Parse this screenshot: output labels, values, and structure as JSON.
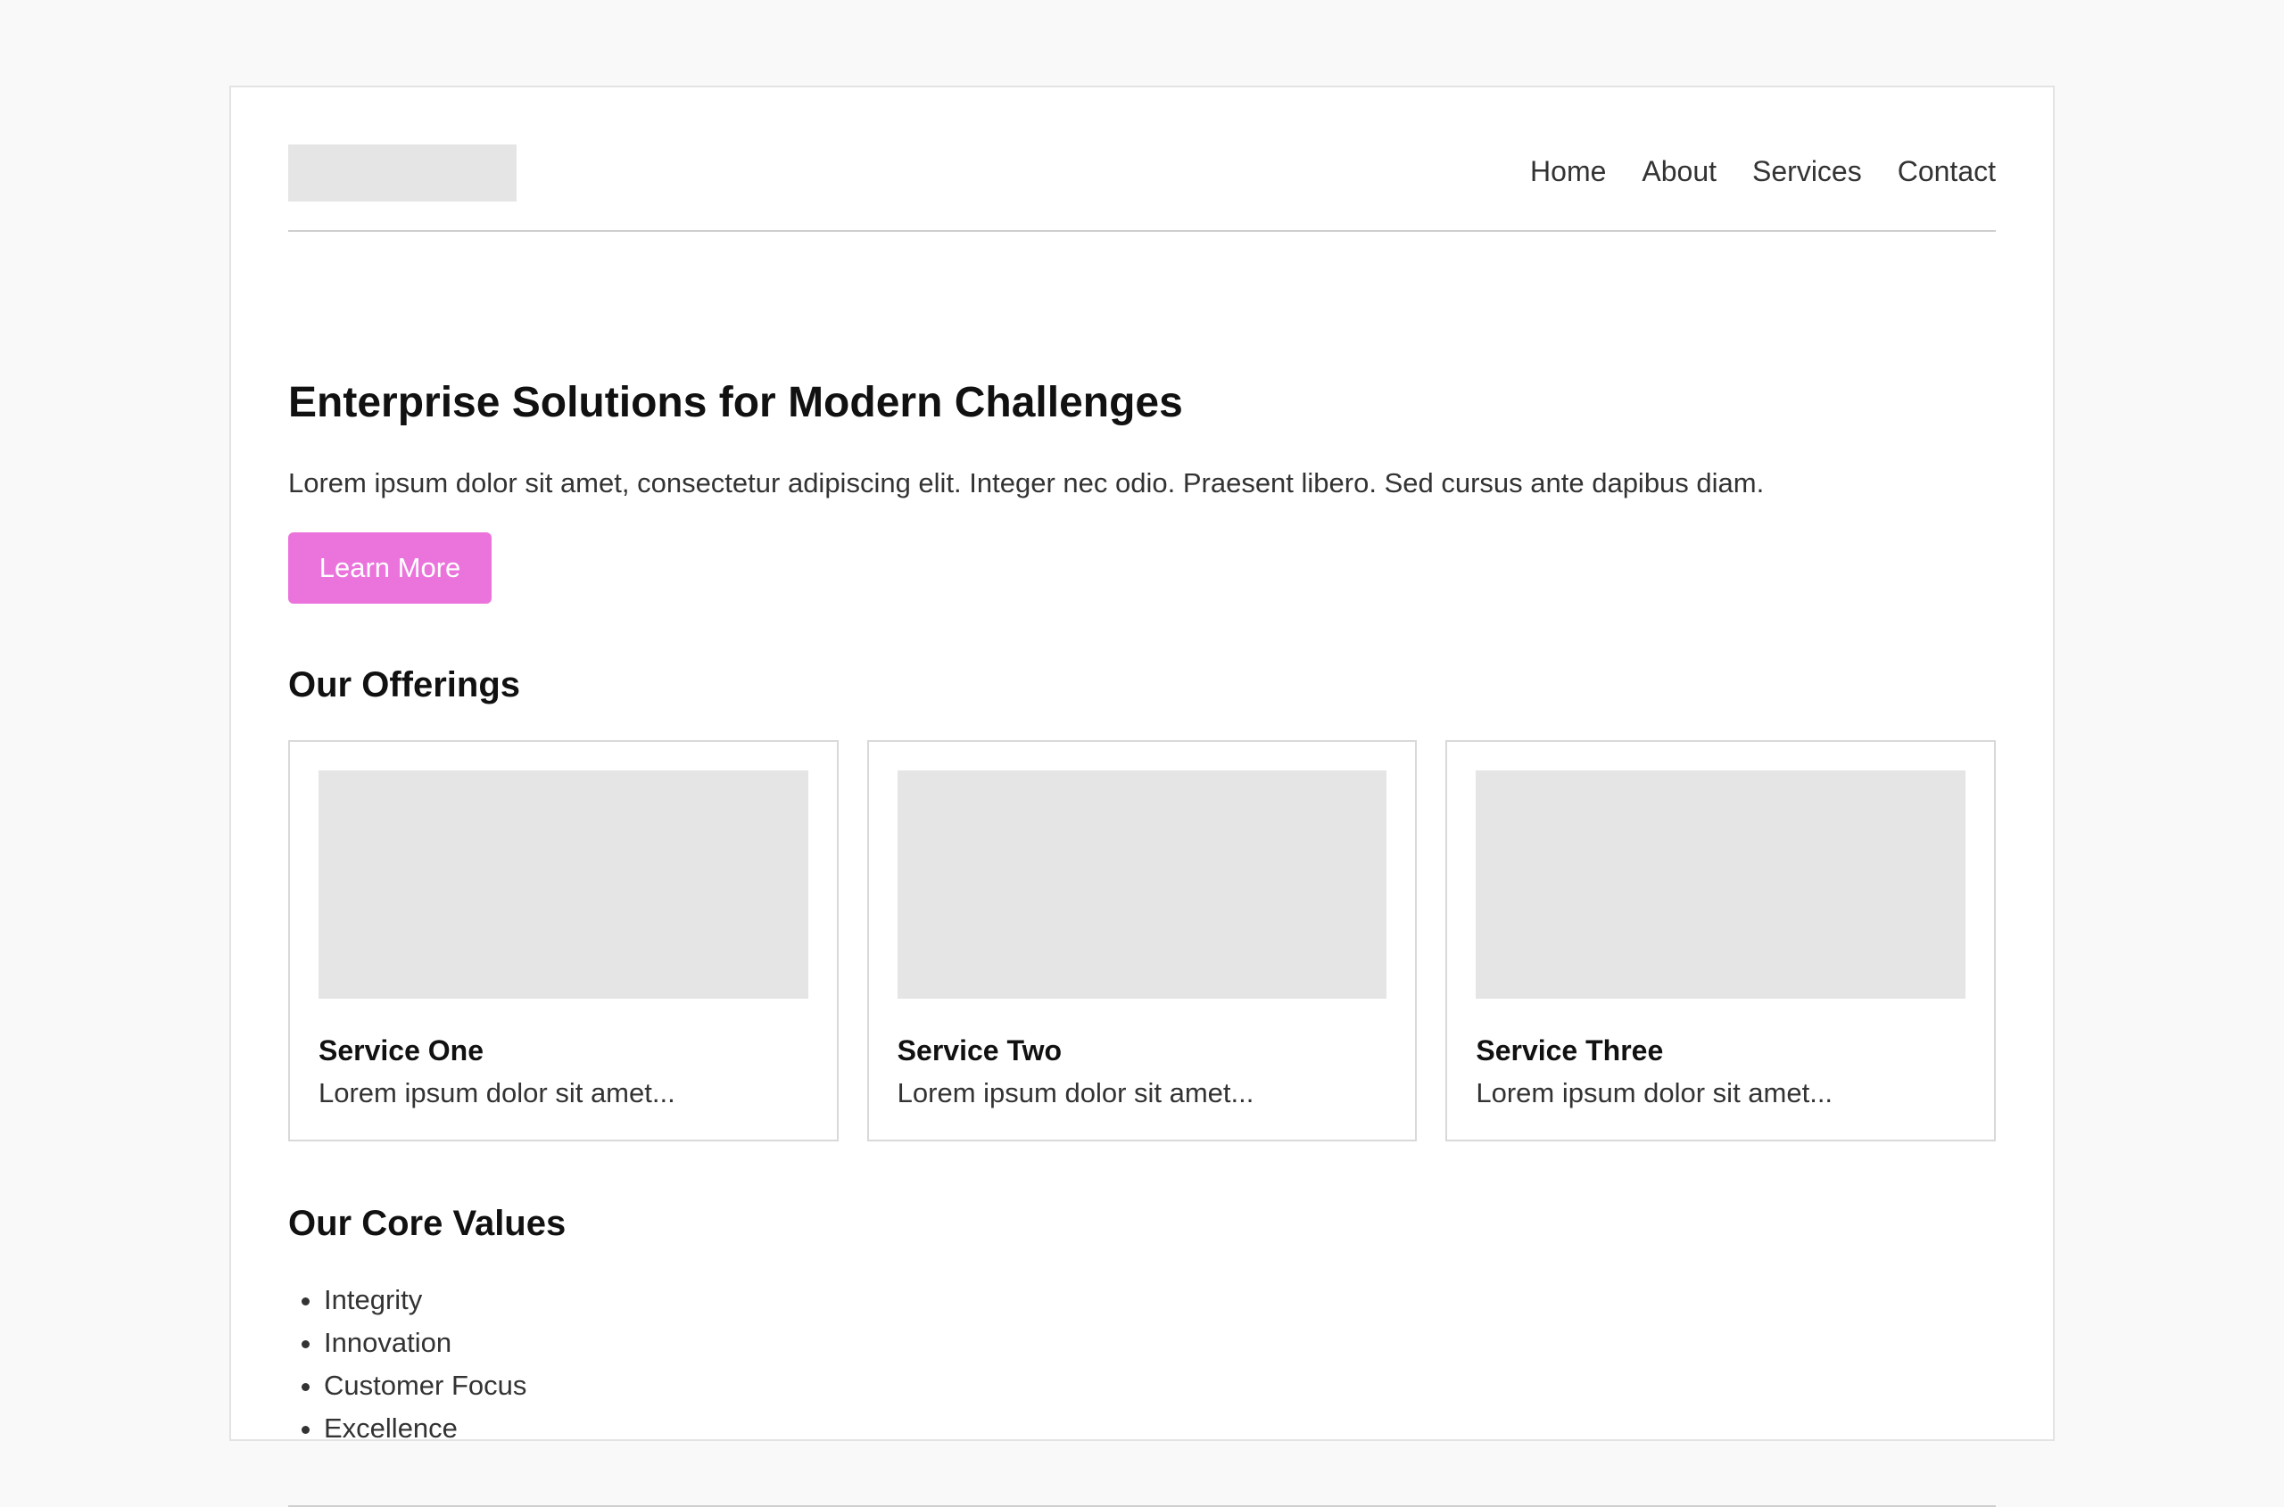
{
  "nav": {
    "items": [
      "Home",
      "About",
      "Services",
      "Contact"
    ]
  },
  "hero": {
    "title": "Enterprise Solutions for Modern Challenges",
    "text": "Lorem ipsum dolor sit amet, consectetur adipiscing elit. Integer nec odio. Praesent libero. Sed cursus ante dapibus diam.",
    "button_label": "Learn More"
  },
  "offerings": {
    "title": "Our Offerings",
    "cards": [
      {
        "title": "Service One",
        "text": "Lorem ipsum dolor sit amet..."
      },
      {
        "title": "Service Two",
        "text": "Lorem ipsum dolor sit amet..."
      },
      {
        "title": "Service Three",
        "text": "Lorem ipsum dolor sit amet..."
      }
    ]
  },
  "values": {
    "title": "Our Core Values",
    "items": [
      "Integrity",
      "Innovation",
      "Customer Focus",
      "Excellence"
    ]
  },
  "colors": {
    "background": "#f9f9f9",
    "accent": "#ea74dc",
    "placeholder": "#e5e5e5"
  }
}
